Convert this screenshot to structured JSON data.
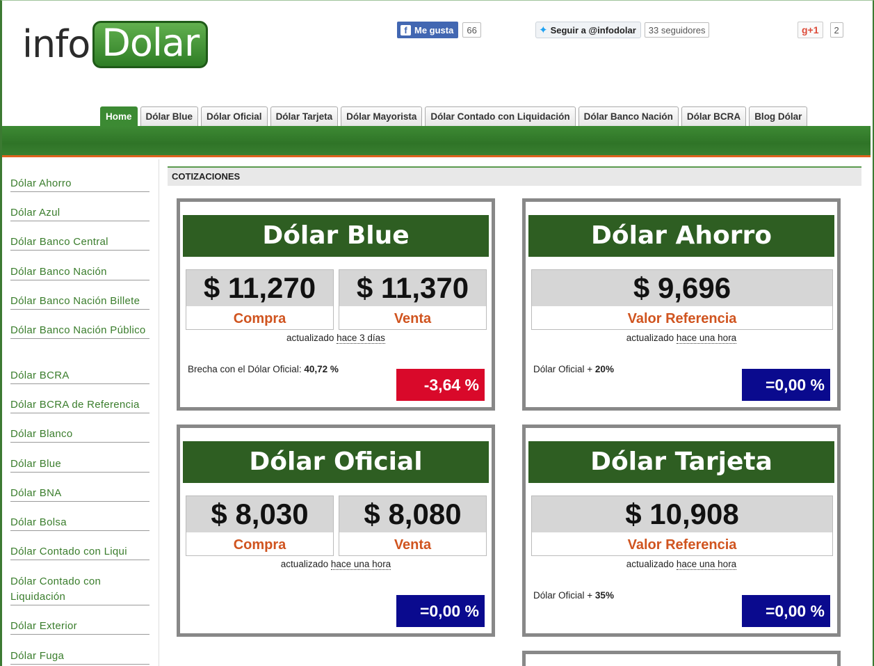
{
  "logo": {
    "part1": "info",
    "part2": "Dolar"
  },
  "social": {
    "facebook": {
      "label": "Me gusta",
      "count": "66",
      "icon": "f"
    },
    "twitter": {
      "label": "Seguir a @infodolar",
      "followers": "33 seguidores",
      "icon": "bird"
    },
    "gplus": {
      "label": "g+1",
      "count": "2"
    }
  },
  "nav": {
    "tabs": [
      "Home",
      "Dólar Blue",
      "Dólar Oficial",
      "Dólar Tarjeta",
      "Dólar Mayorista",
      "Dólar Contado con Liquidación",
      "Dólar Banco Nación",
      "Dólar BCRA",
      "Blog Dólar"
    ]
  },
  "sidebar": {
    "items": [
      "Dólar Ahorro",
      "Dólar Azul",
      "Dólar Banco Central",
      "Dólar Banco Nación",
      "Dólar Banco Nación Billete",
      "Dólar Banco Nación Público",
      "Dólar BCRA",
      "Dólar BCRA de Referencia",
      "Dólar Blanco",
      "Dólar Blue",
      "Dólar BNA",
      "Dólar Bolsa",
      "Dólar Contado con Liqui",
      "Dólar Contado con Liquidación",
      "Dólar Exterior",
      "Dólar Fuga"
    ]
  },
  "main": {
    "section_title": "COTIZACIONES",
    "cards": [
      {
        "title": "Dólar Blue",
        "prices": [
          {
            "value": "$ 11,270",
            "label": "Compra"
          },
          {
            "value": "$ 11,370",
            "label": "Venta"
          }
        ],
        "updated_prefix": "actualizado",
        "updated_ago": "hace 3 días",
        "note_text": "Brecha con el Dólar Oficial:",
        "note_value": "40,72 %",
        "change": "-3,64 %",
        "change_color": "#d9092a"
      },
      {
        "title": "Dólar Ahorro",
        "prices": [
          {
            "value": "$ 9,696",
            "label": "Valor Referencia"
          }
        ],
        "updated_prefix": "actualizado",
        "updated_ago": "hace una hora",
        "note_text": "Dólar Oficial +",
        "note_value": "20%",
        "change": "=0,00 %",
        "change_color": "#0a0a8e"
      },
      {
        "title": "Dólar Oficial",
        "prices": [
          {
            "value": "$ 8,030",
            "label": "Compra"
          },
          {
            "value": "$ 8,080",
            "label": "Venta"
          }
        ],
        "updated_prefix": "actualizado",
        "updated_ago": "hace una hora",
        "note_text": "",
        "note_value": "",
        "change": "=0,00 %",
        "change_color": "#0a0a8e"
      },
      {
        "title": "Dólar Tarjeta",
        "prices": [
          {
            "value": "$ 10,908",
            "label": "Valor Referencia"
          }
        ],
        "updated_prefix": "actualizado",
        "updated_ago": "hace una hora",
        "note_text": "Dólar Oficial +",
        "note_value": "35%",
        "change": "=0,00 %",
        "change_color": "#0a0a8e"
      }
    ]
  }
}
